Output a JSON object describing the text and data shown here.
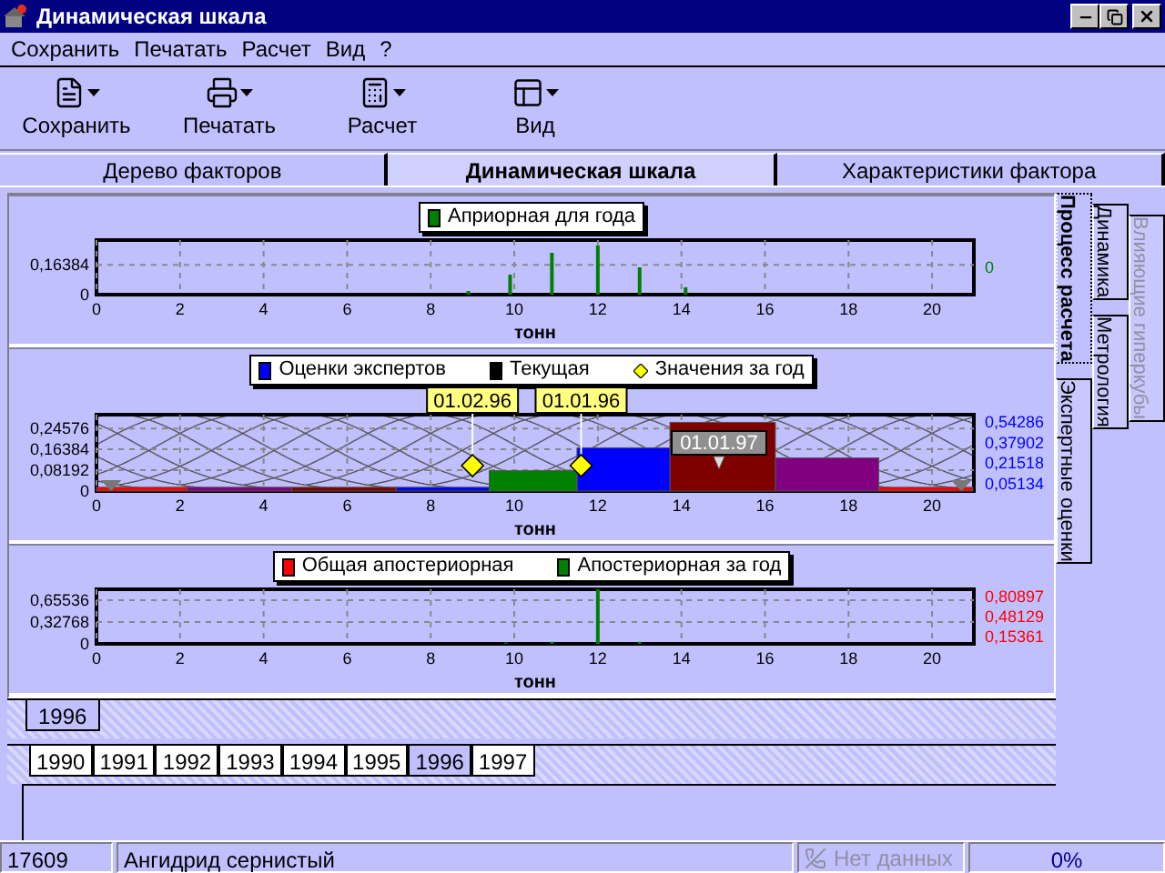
{
  "window": {
    "title": "Динамическая шкала"
  },
  "menu": [
    "Сохранить",
    "Печатать",
    "Расчет",
    "Вид",
    "?"
  ],
  "toolbar": [
    {
      "label": "Сохранить",
      "kind": "save"
    },
    {
      "label": "Печатать",
      "kind": "print"
    },
    {
      "label": "Расчет",
      "kind": "calc"
    },
    {
      "label": "Вид",
      "kind": "view"
    }
  ],
  "tabs": [
    {
      "label": "Дерево факторов",
      "selected": false
    },
    {
      "label": "Динамическая шкала",
      "selected": true
    },
    {
      "label": "Характеристики фактора",
      "selected": false
    }
  ],
  "panels": [
    {
      "kind": "spikes",
      "legend": [
        {
          "label": "Априорная для года",
          "color": "#008000",
          "kind": "square"
        }
      ],
      "right_axis": {
        "color": "#008000",
        "labels": [
          "0"
        ]
      },
      "chart_data": {
        "type": "bar",
        "grid": true,
        "xlabel": "тонн",
        "xlim": [
          0,
          21
        ],
        "ylim": [
          0,
          0.3
        ],
        "xticks": [
          0,
          2,
          4,
          6,
          8,
          10,
          12,
          14,
          16,
          18,
          20
        ],
        "yticks": [
          {
            "value": 0,
            "label": "0"
          },
          {
            "value": 0.16384,
            "label": "0,16384"
          }
        ],
        "x": [
          8.9,
          9.9,
          10.9,
          12,
          13,
          14.1
        ],
        "series": [
          {
            "color": "#008000",
            "values": [
              0.02,
              0.11,
              0.23,
              0.27,
              0.15,
              0.04
            ]
          }
        ]
      }
    },
    {
      "kind": "steps",
      "legend": [
        {
          "label": "Оценки экспертов",
          "color": "#0000ff",
          "kind": "square"
        },
        {
          "label": "Текущая",
          "color": "#000000",
          "kind": "square"
        },
        {
          "label": "Значения за год",
          "color": "#ffff00",
          "kind": "diamond"
        }
      ],
      "right_axis": {
        "color": "#0000ff",
        "labels": [
          "0,54286",
          "0,37902",
          "0,21518",
          "0,05134"
        ]
      },
      "chart_data": {
        "type": "bar",
        "grid": true,
        "xlabel": "тонн",
        "xlim": [
          0,
          21
        ],
        "ylim": [
          0,
          0.3
        ],
        "xticks": [
          0,
          2,
          4,
          6,
          8,
          10,
          12,
          14,
          16,
          18,
          20
        ],
        "yticks": [
          {
            "value": 0,
            "label": "0"
          },
          {
            "value": 0.08192,
            "label": "0,08192"
          },
          {
            "value": 0.16384,
            "label": "0,16384"
          },
          {
            "value": 0.24576,
            "label": "0,24576"
          }
        ],
        "x": [
          1,
          3.35,
          6,
          8.35,
          10.45,
          12.55,
          14.9,
          17.6,
          19.85
        ],
        "series": [
          {
            "color": "#ff0000",
            "values": [
              0.015,
              null,
              null,
              null,
              null,
              null,
              null,
              null,
              0.015
            ]
          },
          {
            "color": "#800080",
            "values": [
              null,
              0.015,
              null,
              null,
              null,
              null,
              null,
              0.13,
              null
            ]
          },
          {
            "color": "#800000",
            "values": [
              null,
              null,
              0.015,
              null,
              null,
              null,
              0.27,
              null,
              null
            ]
          },
          {
            "color": "#0000ff",
            "values": [
              null,
              null,
              null,
              0.015,
              null,
              0.17,
              null,
              null,
              null
            ]
          },
          {
            "color": "#008000",
            "values": [
              null,
              null,
              null,
              null,
              0.08,
              null,
              null,
              null,
              null
            ]
          }
        ],
        "annotations": [
          {
            "x": 9,
            "y": 0.1,
            "text": "01.02.96"
          },
          {
            "x": 11.6,
            "y": 0.1,
            "text": "01.01.96"
          },
          "01.01.97"
        ]
      }
    },
    {
      "kind": "spikes",
      "legend": [
        {
          "label": "Общая апостериорная",
          "color": "#ff0000",
          "kind": "square"
        },
        {
          "label": "Апостериорная за год",
          "color": "#008000",
          "kind": "square"
        }
      ],
      "right_axis": {
        "color": "#ff0000",
        "labels": [
          "0,80897",
          "0,48129",
          "0,15361"
        ]
      },
      "chart_data": {
        "type": "bar",
        "grid": true,
        "xlabel": "тонн",
        "xlim": [
          0,
          21
        ],
        "ylim": [
          0,
          0.82
        ],
        "xticks": [
          0,
          2,
          4,
          6,
          8,
          10,
          12,
          14,
          16,
          18,
          20
        ],
        "yticks": [
          {
            "value": 0,
            "label": "0"
          },
          {
            "value": 0.32768,
            "label": "0,32768"
          },
          {
            "value": 0.65536,
            "label": "0,65536"
          }
        ],
        "x": [
          9.8,
          10.9,
          12,
          13
        ],
        "series": [
          {
            "color": "#008000",
            "values": [
              0.02,
              0.03,
              0.82,
              0.03
            ]
          }
        ]
      }
    }
  ],
  "side_tab_columns": [
    [
      {
        "label": "Процесс расчета",
        "selected": true,
        "disabled": false
      },
      {
        "label": "Экспертные оценки",
        "selected": false,
        "disabled": false
      }
    ],
    [
      {
        "label": "Динамика",
        "selected": false,
        "disabled": false
      },
      {
        "label": "Метрология",
        "selected": false,
        "disabled": false
      }
    ],
    [
      {
        "label": "Влияющие гиперкубы",
        "selected": false,
        "disabled": true
      }
    ]
  ],
  "year_tab": [
    {
      "label": "1996",
      "selected": true
    }
  ],
  "year_tabs": [
    {
      "label": "1990",
      "selected": false
    },
    {
      "label": "1991",
      "selected": false
    },
    {
      "label": "1992",
      "selected": false
    },
    {
      "label": "1993",
      "selected": false
    },
    {
      "label": "1994",
      "selected": false
    },
    {
      "label": "1995",
      "selected": false
    },
    {
      "label": "1996",
      "selected": true
    },
    {
      "label": "1997",
      "selected": false
    }
  ],
  "status_bar": {
    "code": "17609",
    "substance": "Ангидрид сернистый",
    "data_status": {
      "label": "Нет данных",
      "disabled": true
    },
    "progress": {
      "label": "0%",
      "level": 0
    }
  }
}
